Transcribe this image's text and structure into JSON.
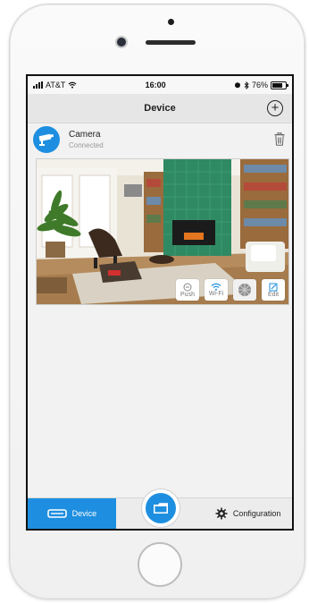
{
  "status_bar": {
    "carrier": "AT&T",
    "time": "16:00",
    "battery": "76%",
    "battery_level": 0.76
  },
  "navbar": {
    "title": "Device",
    "add_label": "+"
  },
  "device": {
    "name": "Camera",
    "status": "Connected"
  },
  "preview_actions": {
    "push_label": "Push",
    "wifi_label": "Wi-Fi",
    "edit_label": "Edit"
  },
  "tabbar": {
    "device_label": "Device",
    "config_label": "Configuration"
  },
  "colors": {
    "accent": "#1e8fe0",
    "navbar_bg": "#e6e6e6",
    "screen_bg": "#f2f2f2"
  }
}
